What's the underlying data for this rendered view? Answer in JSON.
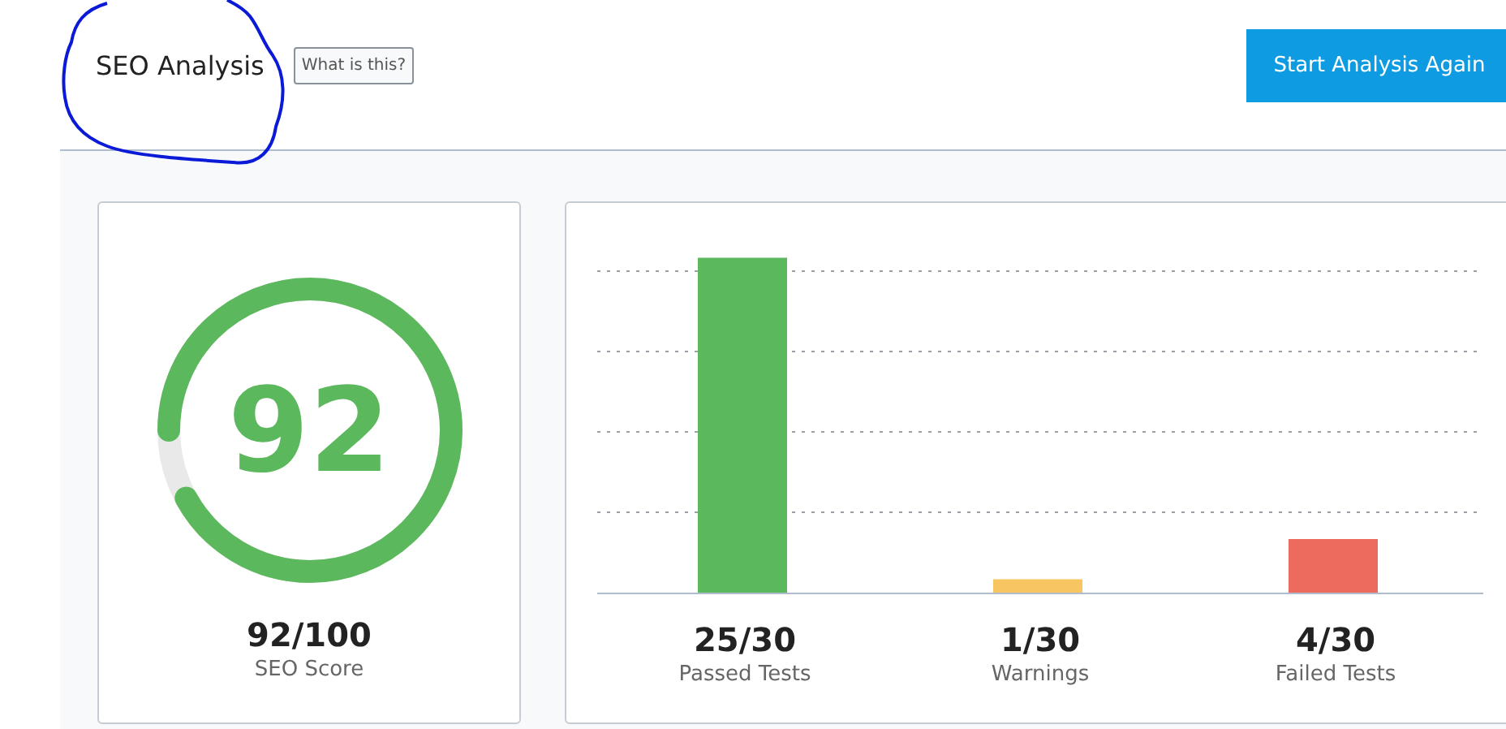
{
  "header": {
    "title": "SEO Analysis",
    "help_button": "What is this?",
    "action_button": "Start Analysis Again"
  },
  "score": {
    "value": "92",
    "level": 0.92,
    "reading": "92/100",
    "label": "SEO Score"
  },
  "results": {
    "chart_data": {
      "type": "bar",
      "categories": [
        "Passed Tests",
        "Warnings",
        "Failed Tests"
      ],
      "values": [
        25,
        1,
        4
      ],
      "data_labels": "value_labels",
      "value_labels": [
        "25/30",
        "1/30",
        "4/30"
      ]
    },
    "bars": [
      {
        "color": "#5cb85c"
      },
      {
        "color": "#f7c663"
      },
      {
        "color": "#ed6a5e"
      }
    ]
  }
}
